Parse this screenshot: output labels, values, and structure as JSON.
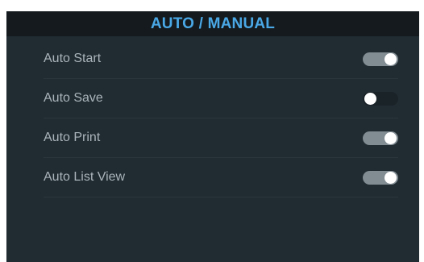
{
  "panel": {
    "title": "AUTO / MANUAL"
  },
  "settings": [
    {
      "label": "Auto Start",
      "enabled": true
    },
    {
      "label": "Auto Save",
      "enabled": false
    },
    {
      "label": "Auto Print",
      "enabled": true
    },
    {
      "label": "Auto List View",
      "enabled": true
    }
  ],
  "colors": {
    "accent": "#4aa8e6",
    "panel_background": "#202b32",
    "header_background": "#141a1e",
    "toggle_on": "#818c93",
    "toggle_off": "#1a2328"
  }
}
